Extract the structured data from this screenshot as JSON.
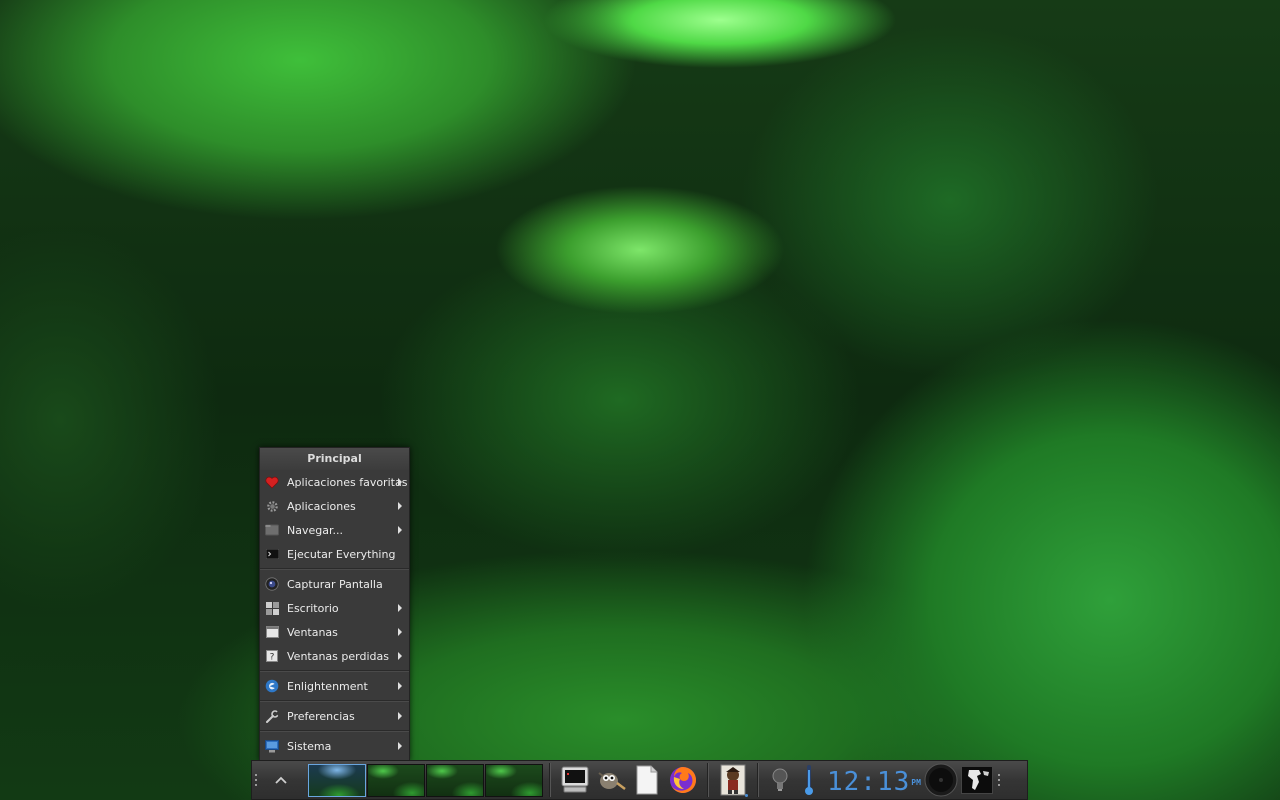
{
  "menu": {
    "title": "Principal",
    "items": [
      {
        "label": "Aplicaciones favoritas",
        "icon": "heart-icon",
        "submenu": true
      },
      {
        "label": "Aplicaciones",
        "icon": "gear-icon",
        "submenu": true
      },
      {
        "label": "Navegar...",
        "icon": "folder-icon",
        "submenu": true
      },
      {
        "label": "Ejecutar Everything",
        "icon": "terminal-icon",
        "submenu": false
      },
      {
        "label": "Capturar Pantalla",
        "icon": "camera-icon",
        "submenu": false
      },
      {
        "label": "Escritorio",
        "icon": "desktop-grid-icon",
        "submenu": true
      },
      {
        "label": "Ventanas",
        "icon": "window-icon",
        "submenu": true
      },
      {
        "label": "Ventanas perdidas",
        "icon": "lost-window-icon",
        "submenu": true
      },
      {
        "label": "Enlightenment",
        "icon": "enlightenment-icon",
        "submenu": true
      },
      {
        "label": "Preferencias",
        "icon": "wrench-icon",
        "submenu": true
      },
      {
        "label": "Sistema",
        "icon": "system-icon",
        "submenu": true
      }
    ]
  },
  "shelf": {
    "launcher_icons": [
      "terminal-launcher-icon",
      "gimp-icon",
      "text-editor-icon",
      "firefox-icon"
    ],
    "task_icon": "game-character-icon",
    "gadget_icons": [
      "lightbulb-icon",
      "thermometer-icon",
      "mixer-knob-icon",
      "world-map-icon"
    ],
    "pager_desktops": 4,
    "clock": {
      "time": "12:13",
      "ampm": "PM"
    }
  },
  "colors": {
    "menu_bg": "#3a3a3a",
    "clock_blue": "#4a90d9",
    "active_desktop_border": "#6aa6e0"
  }
}
